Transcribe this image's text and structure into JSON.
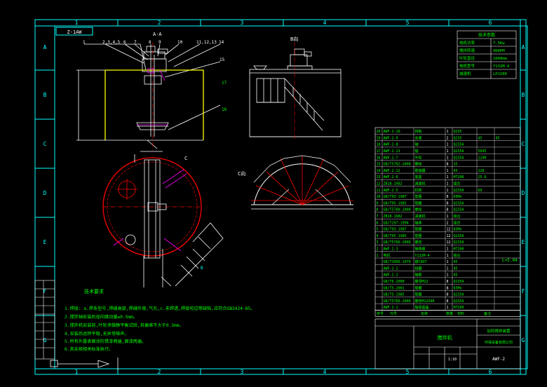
{
  "frame": {
    "top_zones": [
      "1",
      "2",
      "3",
      "4",
      "5",
      "6"
    ],
    "bottom_zones": [
      "1",
      "2",
      "3",
      "4",
      "5",
      "6"
    ],
    "left_zones": [
      "A",
      "B",
      "C",
      "D",
      "E",
      "F",
      "G"
    ],
    "right_zones": [
      "A",
      "B",
      "C",
      "D",
      "E",
      "F",
      "G"
    ]
  },
  "title_box": "Z-1AW",
  "view_labels": {
    "section_aa": "A-A",
    "view_b": "B向",
    "view_c": "C向"
  },
  "leaders": [
    "1",
    "2,3,4,5",
    "6",
    "7",
    "8",
    "9",
    "10",
    "11,12,13",
    "14",
    "15"
  ],
  "side_notes": [
    "17",
    "16"
  ],
  "spec_table": {
    "title": "技术参数",
    "rows": [
      [
        "电机功率",
        "7.5Kw"
      ],
      [
        "搅拌转速",
        "96RPM"
      ],
      [
        "叶轮直径",
        "1000mm"
      ],
      [
        "电机型号",
        "Y132M-4"
      ],
      [
        "减速机",
        "LPJ200"
      ]
    ]
  },
  "tech_req": {
    "title": "技术要求",
    "items": [
      "1.焊接: a.焊条型号,焊缝高度,焊缝外观,气孔,c.未焊透,焊接咬边等缺陷,应符合GB3424-85。",
      "2.搅拌轴安装后径向跳动量≤0.5mm。",
      "3.搅拌机安装前,叶轮须做静平衡试验,其偏差不大于0.3mm。",
      "4.安装后运转平稳,无异常噪声。",
      "5.所有外露表面涂防锈漆两遍,面漆两遍。",
      "6.其余按相关标准执行。"
    ]
  },
  "parts_list": [
    [
      "20",
      "AWF-2-10",
      "挡板",
      "1",
      "Q235"
    ],
    [
      "19",
      "AWF-2-9",
      "支座",
      "2",
      "Q235",
      "45",
      "45"
    ],
    [
      "18",
      "AWF-2-8",
      "轴",
      "1",
      "Q235A"
    ],
    [
      "17",
      "AWF-2-11",
      "轴",
      "1",
      "Q235A",
      "5645"
    ],
    [
      "16",
      "AWF-2-7",
      "叶轮",
      "1",
      "Q235A",
      "1200"
    ],
    [
      "15",
      "GB/T5782-2000",
      "螺栓",
      "8",
      "35"
    ],
    [
      "14",
      "AWF-2-12",
      "联轴器",
      "1",
      "45",
      "128"
    ],
    [
      "13",
      "AWF-2-6",
      "底座",
      "1",
      "HT200",
      "25.6"
    ],
    [
      "12",
      "ZB18-1982",
      "减速机",
      "1",
      "组合"
    ],
    [
      "11",
      "AWF-2-5",
      "机架",
      "1",
      "Q235A",
      "60"
    ],
    [
      "10",
      "GB/T93-1987",
      "垫圈",
      "8",
      "65Mn"
    ],
    [
      "9",
      "GB/T95-1985",
      "垫圈",
      "8",
      "Q235A"
    ],
    [
      "8",
      "GB/T5780-2000",
      "螺栓",
      "8",
      "Q235A"
    ],
    [
      "7",
      "ZB18-1982",
      "减速机",
      "1",
      "组合"
    ],
    [
      "6",
      "GB/T297-1994",
      "轴承",
      "2",
      "组合"
    ],
    [
      "5",
      "GB/T93-1987",
      "垫圈",
      "12",
      "65Mn"
    ],
    [
      "4",
      "GB/T95-1985",
      "垫圈",
      "12",
      "Q235A"
    ],
    [
      "3",
      "GB/T5780-2000",
      "螺栓",
      "12",
      "Q235A"
    ],
    [
      "2",
      "AWF-2-3",
      "轴承座",
      "1",
      "HT200"
    ],
    [
      "1",
      "电机",
      "Y132M-4",
      "1",
      "组合"
    ],
    [
      "",
      "GB/T1096-1979",
      "键C8X7",
      "1",
      "45"
    ],
    [
      "",
      "AWF-2-2",
      "挡圈",
      "1",
      "45"
    ],
    [
      "",
      "AWF-2-1",
      "轴套",
      "1",
      "45"
    ],
    [
      "",
      "GB/T6-2000",
      "螺母M12",
      "8",
      "Q235A"
    ],
    [
      "",
      "GB/T5-2001",
      "垫圈",
      "8",
      "65Mn"
    ],
    [
      "",
      "GB/T5-1985",
      "垫圈",
      "8",
      "Q235A"
    ],
    [
      "",
      "GB/T5780-2000",
      "螺栓M12X40",
      "8",
      "Q235A"
    ],
    [
      "",
      "AWF-2-1",
      "轴承座盖",
      "1",
      "HT200"
    ]
  ],
  "parts_header": [
    "序号",
    "代号",
    "名称",
    "数量",
    "材料",
    "备注"
  ],
  "parts_note": "L=5.04",
  "title_block": {
    "name": "搅拌机",
    "drawing_name": "加药搅拌装置",
    "code": "AWF-2",
    "company": "环保设备有限公司",
    "scale": "1:10"
  },
  "colors": {
    "frame": "#00ffff",
    "tank": "#ffff00",
    "drawing": "#ffffff",
    "hidden": "#ff0000",
    "text_green": "#00ff00",
    "magenta": "#ff00ff"
  }
}
